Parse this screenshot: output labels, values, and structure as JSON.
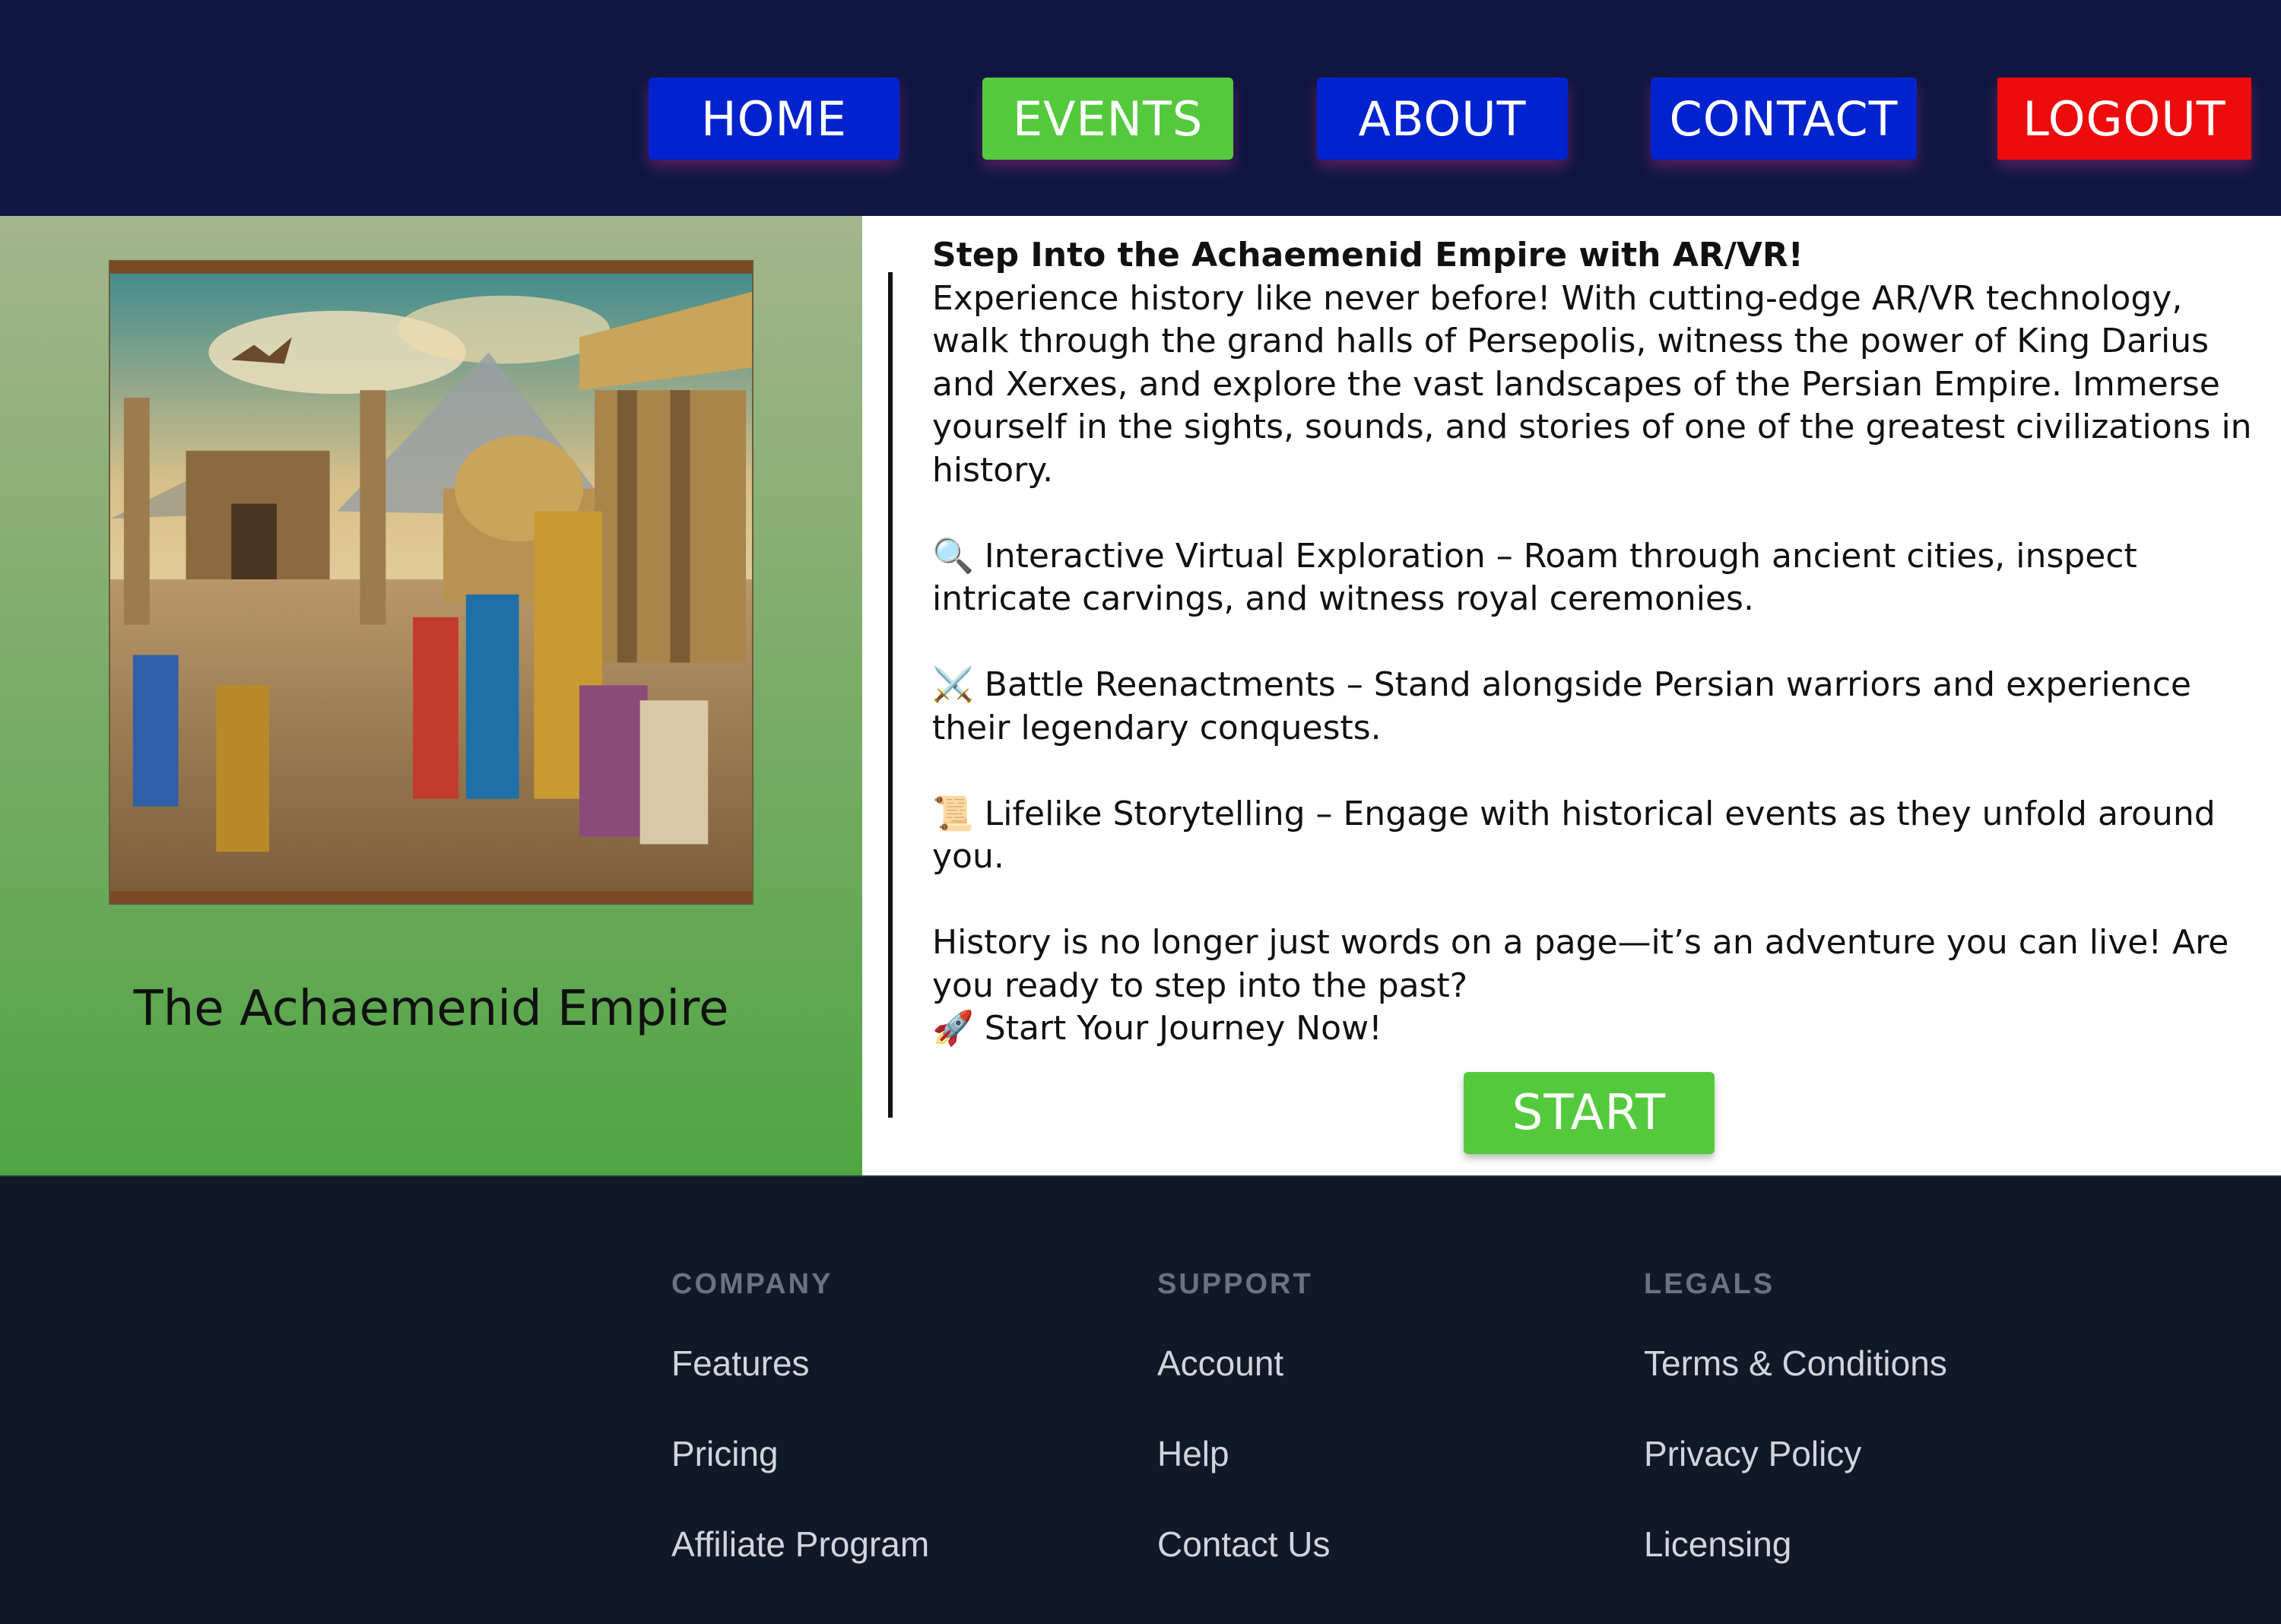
{
  "nav": {
    "home": "HOME",
    "events": "EVENTS",
    "about": "ABOUT",
    "contact": "CONTACT",
    "logout": "LOGOUT"
  },
  "hero": {
    "title": "The Achaemenid Empire"
  },
  "article": {
    "heading": "Step Into the Achaemenid Empire with AR/VR!",
    "intro": "Experience history like never before! With cutting-edge AR/VR technology, walk through the grand halls of Persepolis, witness the power of King Darius and Xerxes, and explore the vast landscapes of the Persian Empire. Immerse yourself in the sights, sounds, and stories of one of the greatest civilizations in history.",
    "feature1": "🔍 Interactive Virtual Exploration – Roam through ancient cities, inspect intricate carvings, and witness royal ceremonies.",
    "feature2": "⚔️ Battle Reenactments – Stand alongside Persian warriors and experience their legendary conquests.",
    "feature3": "📜 Lifelike Storytelling – Engage with historical events as they unfold around you.",
    "closing": "History is no longer just words on a page—it’s an adventure you can live! Are you ready to step into the past?",
    "cta": "🚀 Start Your Journey Now!",
    "start_button": "START"
  },
  "footer": {
    "company": {
      "heading": "COMPANY",
      "links": [
        "Features",
        "Pricing",
        "Affiliate Program"
      ]
    },
    "support": {
      "heading": "SUPPORT",
      "links": [
        "Account",
        "Help",
        "Contact Us"
      ]
    },
    "legals": {
      "heading": "LEGALS",
      "links": [
        "Terms & Conditions",
        "Privacy Policy",
        "Licensing"
      ]
    }
  },
  "colors": {
    "header_bg": "#0f1640",
    "nav_blue": "#0023cf",
    "nav_active_green": "#55c93d",
    "logout_red": "#ee0b0b",
    "footer_bg": "#111827"
  }
}
